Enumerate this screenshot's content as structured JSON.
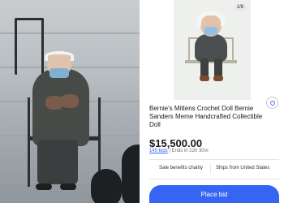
{
  "listing": {
    "image_counter": "1/8",
    "title": "Bernie's Mittens Crochet Doll Bernie Sanders Meme Handcrafted Collectible Doll",
    "price": "$15,500.00",
    "bids": "149 bids",
    "ends": " | Ends in 22h 30m",
    "perk_charity": "Sale benefits charity",
    "perk_shipping": "Ships from United States",
    "place_bid_label": "Place bid"
  },
  "icons": {
    "watch": "heart-icon"
  },
  "colors": {
    "accent": "#3665f3",
    "price_text": "#191919",
    "muted_text": "#707070"
  }
}
